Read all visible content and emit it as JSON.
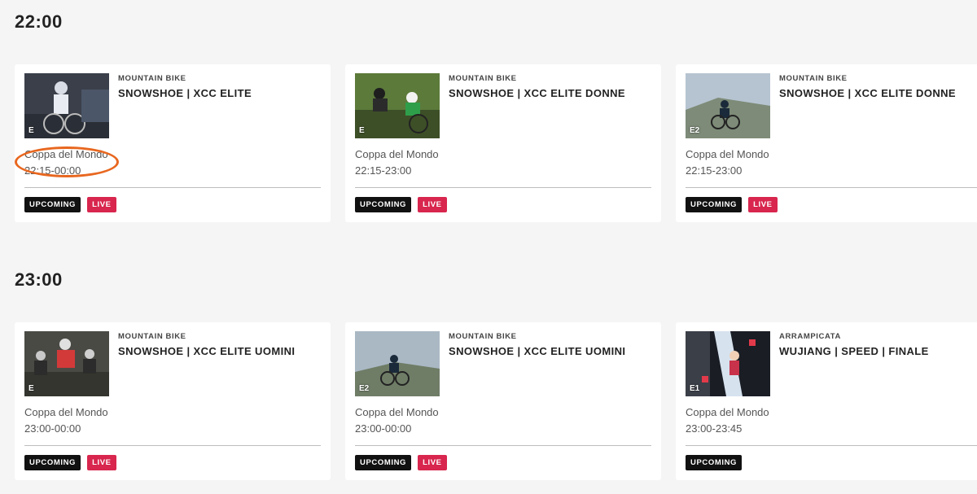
{
  "groups": [
    {
      "time": "22:00",
      "cards": [
        {
          "sport": "MOUNTAIN BIKE",
          "title": "SNOWSHOE | XCC ELITE",
          "competition": "Coppa del Mondo",
          "schedule": "22:15-00:00",
          "channel": "E",
          "badge_upcoming": "UPCOMING",
          "badge_live": "LIVE"
        },
        {
          "sport": "MOUNTAIN BIKE",
          "title": "SNOWSHOE | XCC ELITE DONNE",
          "competition": "Coppa del Mondo",
          "schedule": "22:15-23:00",
          "channel": "E",
          "badge_upcoming": "UPCOMING",
          "badge_live": "LIVE"
        },
        {
          "sport": "MOUNTAIN BIKE",
          "title": "SNOWSHOE | XCC ELITE DONNE",
          "competition": "Coppa del Mondo",
          "schedule": "22:15-23:00",
          "channel": "E2",
          "badge_upcoming": "UPCOMING",
          "badge_live": "LIVE"
        }
      ]
    },
    {
      "time": "23:00",
      "cards": [
        {
          "sport": "MOUNTAIN BIKE",
          "title": "SNOWSHOE | XCC ELITE UOMINI",
          "competition": "Coppa del Mondo",
          "schedule": "23:00-00:00",
          "channel": "E",
          "badge_upcoming": "UPCOMING",
          "badge_live": "LIVE"
        },
        {
          "sport": "MOUNTAIN BIKE",
          "title": "SNOWSHOE | XCC ELITE UOMINI",
          "competition": "Coppa del Mondo",
          "schedule": "23:00-00:00",
          "channel": "E2",
          "badge_upcoming": "UPCOMING",
          "badge_live": "LIVE"
        },
        {
          "sport": "ARRAMPICATA",
          "title": "WUJIANG | SPEED | FINALE",
          "competition": "Coppa del Mondo",
          "schedule": "23:00-23:45",
          "channel": "E1",
          "badge_upcoming": "UPCOMING"
        }
      ]
    }
  ],
  "colors": {
    "live": "#d8264e",
    "upcoming": "#111111",
    "annotation": "#e8671f"
  }
}
